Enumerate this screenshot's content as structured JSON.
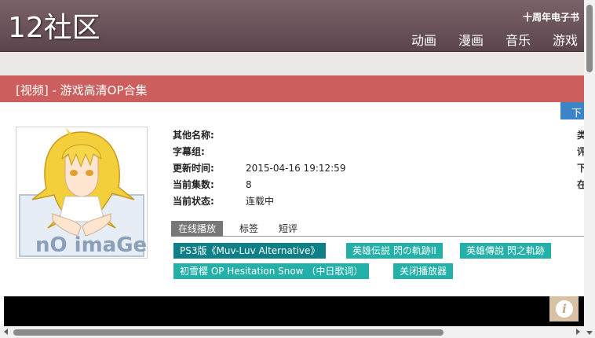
{
  "header": {
    "logo": "12社区",
    "ebook_link": "十周年电子书",
    "nav": [
      "动画",
      "漫画",
      "音乐",
      "游戏"
    ]
  },
  "page": {
    "title": "[视频] - 游戏高清OP合集",
    "download_label": "下"
  },
  "cover": {
    "placeholder_text": "nO imaGe"
  },
  "meta": [
    {
      "label": "其他名称:",
      "value": ""
    },
    {
      "label": "字幕组:",
      "value": ""
    },
    {
      "label": "更新时间:",
      "value": "2015-04-16 19:12:59"
    },
    {
      "label": "当前集数:",
      "value": "8"
    },
    {
      "label": "当前状态:",
      "value": "连载中"
    }
  ],
  "right_column": [
    "类",
    "评",
    "下",
    "在"
  ],
  "tabs": [
    "在线播放",
    "标签",
    "短评"
  ],
  "sources": [
    "PS3版《Muv-Luv Alternative》",
    "英雄伝説 閃の軌跡II",
    "英雄傳說 閃之軌跡",
    "初雪樱 OP Hesitation Snow （中日歌词）",
    "关闭播放器"
  ],
  "player": {
    "info_icon": "i"
  },
  "colors": {
    "header": "#5b454c",
    "title_bar": "#cd5e5e",
    "source_active": "#0e7f86",
    "source_normal": "#22b0a8",
    "download": "#3d84c6"
  }
}
